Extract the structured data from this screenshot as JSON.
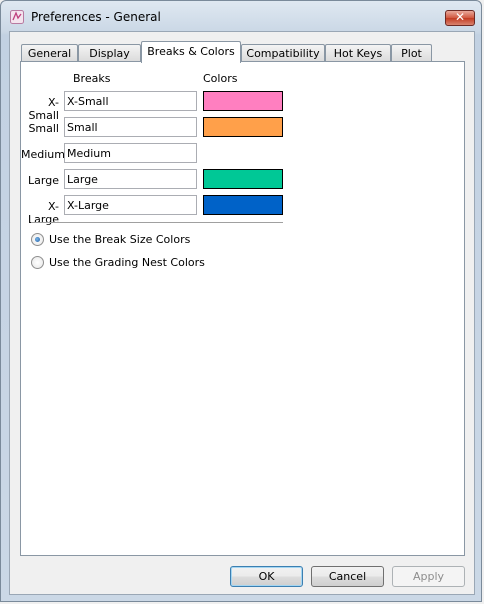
{
  "window": {
    "title": "Preferences - General"
  },
  "tabs": [
    "General",
    "Display",
    "Breaks & Colors",
    "Compatibility",
    "Hot Keys",
    "Plot"
  ],
  "active_tab": "Breaks & Colors",
  "breaks_panel": {
    "breaks_header": "Breaks",
    "colors_header": "Colors",
    "rows": [
      {
        "label": "X-Small",
        "value": "X-Small",
        "color": "#ff7fc0"
      },
      {
        "label": "Small",
        "value": "Small",
        "color": "#ffa04a"
      },
      {
        "label": "Medium",
        "value": "Medium",
        "color": null
      },
      {
        "label": "Large",
        "value": "Large",
        "color": "#00c896"
      },
      {
        "label": "X-Large",
        "value": "X-Large",
        "color": "#0062c8"
      }
    ],
    "options": [
      {
        "label": "Use the Break Size Colors",
        "checked": true
      },
      {
        "label": "Use the Grading Nest Colors",
        "checked": false
      }
    ]
  },
  "buttons": {
    "ok": "OK",
    "cancel": "Cancel",
    "apply": "Apply"
  }
}
